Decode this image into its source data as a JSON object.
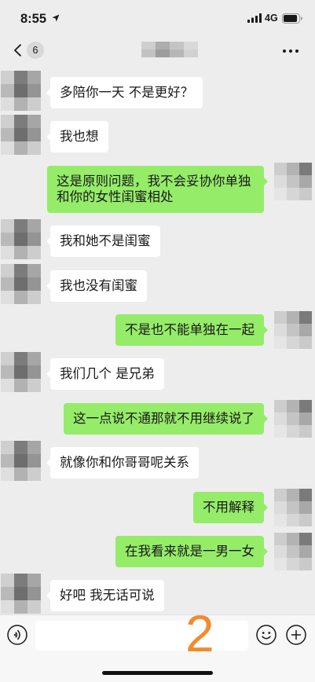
{
  "status_bar": {
    "time": "8:55",
    "network": "4G",
    "signal_bars": 4,
    "battery_level": 0.9
  },
  "nav": {
    "unread_count": "6"
  },
  "chat": {
    "messages": [
      {
        "outgoing": false,
        "text": "多陪你一天 不是更好？"
      },
      {
        "outgoing": false,
        "text": "我也想"
      },
      {
        "outgoing": true,
        "text": "这是原则问题，我不会妥协你单独和你的女性闺蜜相处"
      },
      {
        "outgoing": false,
        "text": "我和她不是闺蜜"
      },
      {
        "outgoing": false,
        "text": "我也没有闺蜜"
      },
      {
        "outgoing": true,
        "text": "不是也不能单独在一起"
      },
      {
        "outgoing": false,
        "text": "我们几个 是兄弟"
      },
      {
        "outgoing": true,
        "text": "这一点说不通那就不用继续说了"
      },
      {
        "outgoing": false,
        "text": "就像你和你哥哥呢关系"
      },
      {
        "outgoing": true,
        "text": "不用解释"
      },
      {
        "outgoing": true,
        "text": "在我看来就是一男一女"
      },
      {
        "outgoing": false,
        "text": "好吧 我无话可说"
      }
    ]
  },
  "input_bar": {
    "value": ""
  },
  "annotation": {
    "label": "2"
  },
  "icons": {
    "location": "location-arrow-icon",
    "signal": "cellular-signal-icon",
    "battery": "battery-icon",
    "back": "chevron-left-icon",
    "more": "more-dots-icon",
    "voice": "voice-icon",
    "emoji": "emoji-icon",
    "add": "plus-circle-icon"
  },
  "colors": {
    "chat_background": "#ededed",
    "sent_bubble": "#95ec69",
    "received_bubble": "#ffffff",
    "annotation": "#f28b2d"
  }
}
